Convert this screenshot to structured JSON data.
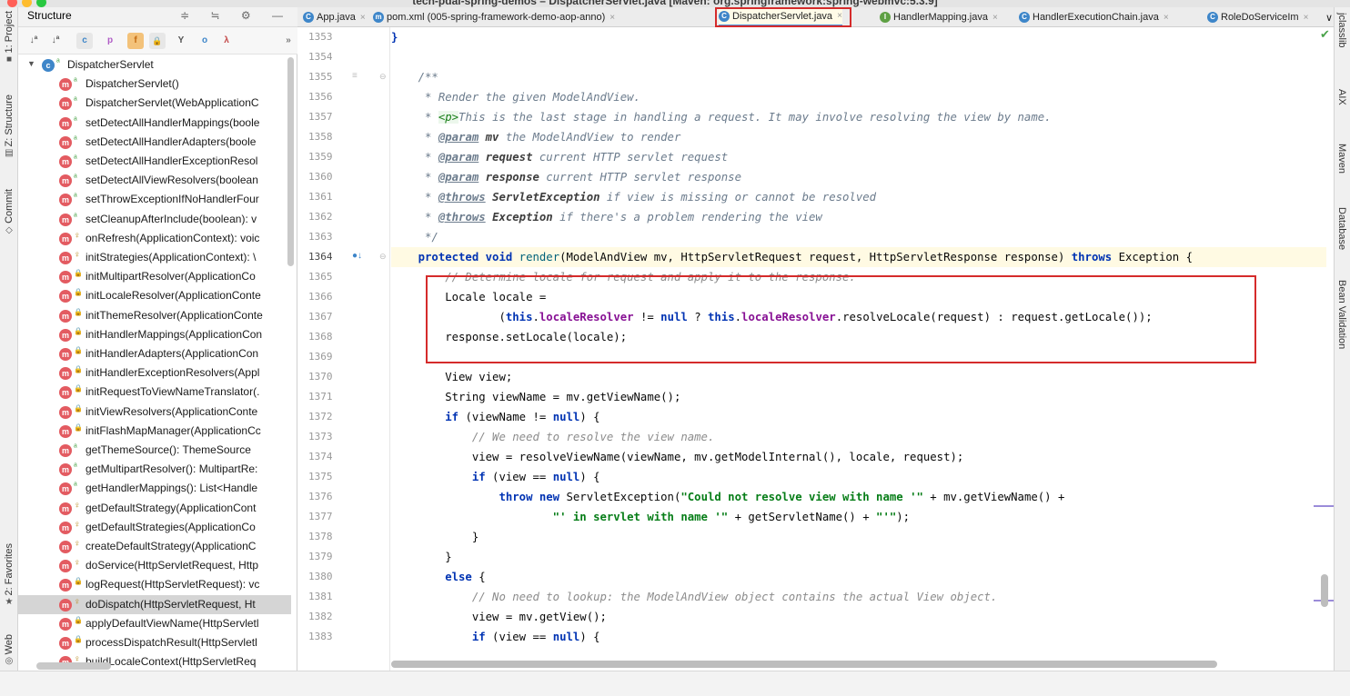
{
  "window": {
    "title": "tech-pdai-spring-demos – DispatcherServlet.java [Maven: org.springframework:spring-webmvc:5.3.9]"
  },
  "left_strip": {
    "tabs": [
      {
        "label": "1: Project"
      },
      {
        "label": "Z: Structure"
      },
      {
        "label": "Commit"
      },
      {
        "label": "2: Favorites"
      },
      {
        "label": "Web"
      }
    ]
  },
  "structure_panel": {
    "title": "Structure",
    "header_icons": "≑ ≒ ⚙ —",
    "toolbar_icons": [
      {
        "glyph": "↓ª",
        "name": "sort-alpha-icon"
      },
      {
        "glyph": "↓ª",
        "name": "sort-visibility-icon"
      },
      {
        "glyph": "c",
        "name": "show-inherited-icon"
      },
      {
        "glyph": "p",
        "name": "show-properties-icon"
      },
      {
        "glyph": "f",
        "name": "show-fields-icon"
      },
      {
        "glyph": "🔒",
        "name": "show-non-public-icon"
      },
      {
        "glyph": "Y",
        "name": "filter-icon"
      },
      {
        "glyph": "o",
        "name": "show-anonymous-icon"
      },
      {
        "glyph": "λ",
        "name": "show-lambdas-icon"
      },
      {
        "glyph": "»",
        "name": "more-icon"
      }
    ],
    "root": "DispatcherServlet",
    "items": [
      {
        "label": "DispatcherServlet()",
        "vis": "pub"
      },
      {
        "label": "DispatcherServlet(WebApplicationC",
        "vis": "pub"
      },
      {
        "label": "setDetectAllHandlerMappings(boole",
        "vis": "pub"
      },
      {
        "label": "setDetectAllHandlerAdapters(boole",
        "vis": "pub"
      },
      {
        "label": "setDetectAllHandlerExceptionResol",
        "vis": "pub"
      },
      {
        "label": "setDetectAllViewResolvers(boolean",
        "vis": "pub"
      },
      {
        "label": "setThrowExceptionIfNoHandlerFour",
        "vis": "pub"
      },
      {
        "label": "setCleanupAfterInclude(boolean): v",
        "vis": "pub"
      },
      {
        "label": "onRefresh(ApplicationContext): voic",
        "vis": "prot"
      },
      {
        "label": "initStrategies(ApplicationContext): \\",
        "vis": "prot"
      },
      {
        "label": "initMultipartResolver(ApplicationCo",
        "vis": "priv"
      },
      {
        "label": "initLocaleResolver(ApplicationConte",
        "vis": "priv"
      },
      {
        "label": "initThemeResolver(ApplicationConte",
        "vis": "priv"
      },
      {
        "label": "initHandlerMappings(ApplicationCon",
        "vis": "priv"
      },
      {
        "label": "initHandlerAdapters(ApplicationCon",
        "vis": "priv"
      },
      {
        "label": "initHandlerExceptionResolvers(Appl",
        "vis": "priv"
      },
      {
        "label": "initRequestToViewNameTranslator(.",
        "vis": "priv"
      },
      {
        "label": "initViewResolvers(ApplicationConte",
        "vis": "priv"
      },
      {
        "label": "initFlashMapManager(ApplicationCc",
        "vis": "priv"
      },
      {
        "label": "getThemeSource(): ThemeSource",
        "vis": "pub"
      },
      {
        "label": "getMultipartResolver(): MultipartRe:",
        "vis": "pub"
      },
      {
        "label": "getHandlerMappings(): List<Handle",
        "vis": "pub"
      },
      {
        "label": "getDefaultStrategy(ApplicationCont",
        "vis": "prot"
      },
      {
        "label": "getDefaultStrategies(ApplicationCo",
        "vis": "prot"
      },
      {
        "label": "createDefaultStrategy(ApplicationC",
        "vis": "prot"
      },
      {
        "label": "doService(HttpServletRequest, Http",
        "vis": "prot"
      },
      {
        "label": "logRequest(HttpServletRequest): vc",
        "vis": "priv"
      },
      {
        "label": "doDispatch(HttpServletRequest, Ht",
        "vis": "prot",
        "selected": true
      },
      {
        "label": "applyDefaultViewName(HttpServletl",
        "vis": "priv"
      },
      {
        "label": "processDispatchResult(HttpServletl",
        "vis": "priv"
      },
      {
        "label": "buildLocaleContext(HttpServletReq",
        "vis": "prot"
      }
    ]
  },
  "editor": {
    "tabs": [
      {
        "label": "App.java",
        "icon": "C"
      },
      {
        "label": "pom.xml (005-spring-framework-demo-aop-anno)",
        "icon": "m"
      },
      {
        "label": "DispatcherServlet.java",
        "icon": "C",
        "active": true
      },
      {
        "label": "HandlerMapping.java",
        "icon": "I"
      },
      {
        "label": "HandlerExecutionChain.java",
        "icon": "C"
      },
      {
        "label": "RoleDoServiceIm",
        "icon": "C"
      }
    ],
    "tabs_overflow": "∨",
    "line_numbers": [
      "1353",
      "1354",
      "1355",
      "1356",
      "1357",
      "1358",
      "1359",
      "1360",
      "1361",
      "1362",
      "1363",
      "1364",
      "1365",
      "1366",
      "1367",
      "1368",
      "1369",
      "1370",
      "1371",
      "1372",
      "1373",
      "1374",
      "1375",
      "1376",
      "1377",
      "1378",
      "1379",
      "1380",
      "1381",
      "1382",
      "1383"
    ],
    "right_strip": [
      "jclasslib",
      "AIX",
      "Maven",
      "Database",
      "Bean Validation"
    ]
  },
  "colors": {
    "highlight_box": "#d52b2b",
    "keyword": "#0033b3",
    "current_line": "#fffae3"
  }
}
